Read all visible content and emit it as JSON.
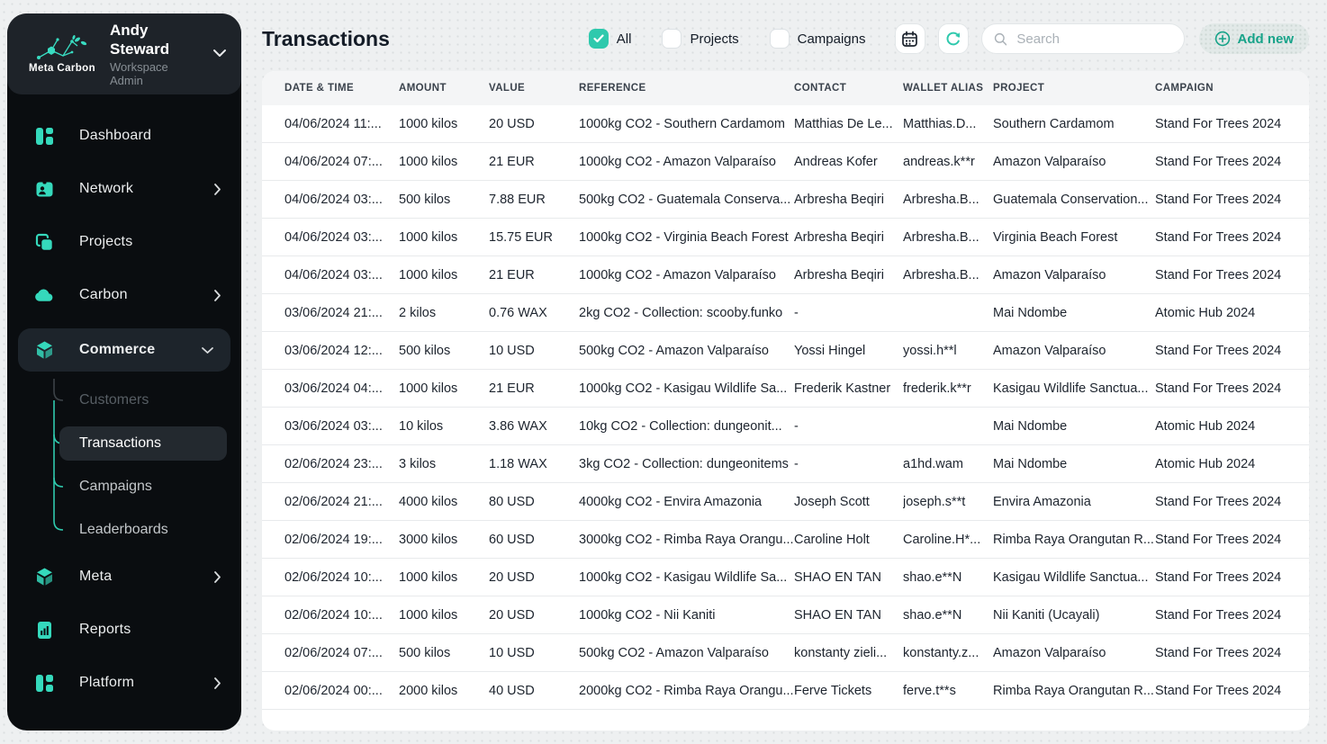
{
  "brand": {
    "name": "Meta Carbon"
  },
  "user": {
    "name": "Andy Steward",
    "role": "Workspace Admin"
  },
  "colors": {
    "accent": "#2fc9ad",
    "sidebar_bg": "#0a0d10",
    "sidebar_header_bg": "#1e2329",
    "active_pill_bg": "#1d242b",
    "active_subitem_bg": "#23292f",
    "page_bg": "#eef0f1",
    "card_bg": "#ffffff",
    "table_header_bg": "#f4f5f6",
    "text_dark": "#1d242e"
  },
  "icons": {
    "user_chevron": "chevron-down",
    "dashboard": "grid-blocks",
    "network": "id-badge",
    "projects": "stacked-squares",
    "carbon": "cloud",
    "commerce": "cube",
    "meta": "cube",
    "reports": "document-bar-chart",
    "platform": "grid-blocks",
    "calendar": "calendar",
    "refresh": "circular-arrow",
    "search": "magnifier",
    "add_new": "circle-plus",
    "checked": "checkmark"
  },
  "sidebar": {
    "items": [
      {
        "label": "Dashboard"
      },
      {
        "label": "Network",
        "chevron": "right"
      },
      {
        "label": "Projects"
      },
      {
        "label": "Carbon",
        "chevron": "right"
      },
      {
        "label": "Commerce",
        "chevron": "down",
        "active": true,
        "children": [
          {
            "label": "Customers",
            "muted": true
          },
          {
            "label": "Transactions",
            "active": true
          },
          {
            "label": "Campaigns"
          },
          {
            "label": "Leaderboards"
          }
        ]
      },
      {
        "label": "Meta",
        "chevron": "right"
      },
      {
        "label": "Reports"
      },
      {
        "label": "Platform",
        "chevron": "right"
      }
    ]
  },
  "header": {
    "title": "Transactions",
    "filters": [
      {
        "label": "All",
        "checked": true
      },
      {
        "label": "Projects",
        "checked": false
      },
      {
        "label": "Campaigns",
        "checked": false
      }
    ],
    "search_placeholder": "Search",
    "add_new_label": "Add new"
  },
  "table": {
    "columns": [
      "DATE & TIME",
      "AMOUNT",
      "VALUE",
      "REFERENCE",
      "CONTACT",
      "WALLET ALIAS",
      "PROJECT",
      "CAMPAIGN"
    ],
    "col_keys": [
      "date",
      "amount",
      "value",
      "reference",
      "contact",
      "wallet",
      "project",
      "campaign"
    ],
    "rows": [
      {
        "date": "04/06/2024 11:...",
        "amount": "1000 kilos",
        "value": "20 USD",
        "reference": "1000kg CO2 - Southern Cardamom",
        "contact": "Matthias De Le...",
        "wallet": "Matthias.D...",
        "project": "Southern Cardamom",
        "campaign": "Stand For Trees 2024"
      },
      {
        "date": "04/06/2024 07:...",
        "amount": "1000 kilos",
        "value": "21 EUR",
        "reference": "1000kg CO2 - Amazon Valparaíso",
        "contact": "Andreas Kofer",
        "wallet": "andreas.k**r",
        "project": "Amazon Valparaíso",
        "campaign": "Stand For Trees 2024"
      },
      {
        "date": "04/06/2024 03:...",
        "amount": "500 kilos",
        "value": "7.88 EUR",
        "reference": "500kg CO2 - Guatemala Conserva...",
        "contact": "Arbresha Beqiri",
        "wallet": "Arbresha.B...",
        "project": "Guatemala Conservation...",
        "campaign": "Stand For Trees 2024"
      },
      {
        "date": "04/06/2024 03:...",
        "amount": "1000 kilos",
        "value": "15.75 EUR",
        "reference": "1000kg CO2 - Virginia Beach Forest",
        "contact": "Arbresha Beqiri",
        "wallet": "Arbresha.B...",
        "project": "Virginia Beach Forest",
        "campaign": "Stand For Trees 2024"
      },
      {
        "date": "04/06/2024 03:...",
        "amount": "1000 kilos",
        "value": "21 EUR",
        "reference": "1000kg CO2 - Amazon Valparaíso",
        "contact": "Arbresha Beqiri",
        "wallet": "Arbresha.B...",
        "project": "Amazon Valparaíso",
        "campaign": "Stand For Trees 2024"
      },
      {
        "date": "03/06/2024 21:...",
        "amount": "2 kilos",
        "value": "0.76 WAX",
        "reference": "2kg CO2 - Collection: scooby.funko",
        "contact": "-",
        "wallet": "",
        "project": "Mai Ndombe",
        "campaign": "Atomic Hub 2024"
      },
      {
        "date": "03/06/2024 12:...",
        "amount": "500 kilos",
        "value": "10 USD",
        "reference": "500kg CO2 - Amazon Valparaíso",
        "contact": "Yossi Hingel",
        "wallet": "yossi.h**l",
        "project": "Amazon Valparaíso",
        "campaign": "Stand For Trees 2024"
      },
      {
        "date": "03/06/2024 04:...",
        "amount": "1000 kilos",
        "value": "21 EUR",
        "reference": "1000kg CO2 - Kasigau Wildlife Sa...",
        "contact": "Frederik Kastner",
        "wallet": "frederik.k**r",
        "project": "Kasigau Wildlife Sanctua...",
        "campaign": "Stand For Trees 2024"
      },
      {
        "date": "03/06/2024 03:...",
        "amount": "10 kilos",
        "value": "3.86 WAX",
        "reference": "10kg CO2 - Collection: dungeonit...",
        "contact": "-",
        "wallet": "",
        "project": "Mai Ndombe",
        "campaign": "Atomic Hub 2024"
      },
      {
        "date": "02/06/2024 23:...",
        "amount": "3 kilos",
        "value": "1.18 WAX",
        "reference": "3kg CO2 - Collection: dungeonitems",
        "contact": "-",
        "wallet": "a1hd.wam",
        "project": "Mai Ndombe",
        "campaign": "Atomic Hub 2024"
      },
      {
        "date": "02/06/2024 21:...",
        "amount": "4000 kilos",
        "value": "80 USD",
        "reference": "4000kg CO2 - Envira Amazonia",
        "contact": "Joseph Scott",
        "wallet": "joseph.s**t",
        "project": "Envira Amazonia",
        "campaign": "Stand For Trees 2024"
      },
      {
        "date": "02/06/2024 19:...",
        "amount": "3000 kilos",
        "value": "60 USD",
        "reference": "3000kg CO2 - Rimba Raya Orangu...",
        "contact": "Caroline Holt",
        "wallet": "Caroline.H*...",
        "project": "Rimba Raya Orangutan R...",
        "campaign": "Stand For Trees 2024"
      },
      {
        "date": "02/06/2024 10:...",
        "amount": "1000 kilos",
        "value": "20 USD",
        "reference": "1000kg CO2 - Kasigau Wildlife Sa...",
        "contact": "SHAO EN TAN",
        "wallet": "shao.e**N",
        "project": "Kasigau Wildlife Sanctua...",
        "campaign": "Stand For Trees 2024"
      },
      {
        "date": "02/06/2024 10:...",
        "amount": "1000 kilos",
        "value": "20 USD",
        "reference": "1000kg CO2 - Nii Kaniti",
        "contact": "SHAO EN TAN",
        "wallet": "shao.e**N",
        "project": "Nii Kaniti (Ucayali)",
        "campaign": "Stand For Trees 2024"
      },
      {
        "date": "02/06/2024 07:...",
        "amount": "500 kilos",
        "value": "10 USD",
        "reference": "500kg CO2 - Amazon Valparaíso",
        "contact": "konstanty zieli...",
        "wallet": "konstanty.z...",
        "project": "Amazon Valparaíso",
        "campaign": "Stand For Trees 2024"
      },
      {
        "date": "02/06/2024 00:...",
        "amount": "2000 kilos",
        "value": "40 USD",
        "reference": "2000kg CO2 - Rimba Raya Orangu...",
        "contact": "Ferve Tickets",
        "wallet": "ferve.t**s",
        "project": "Rimba Raya Orangutan R...",
        "campaign": "Stand For Trees 2024"
      }
    ]
  }
}
